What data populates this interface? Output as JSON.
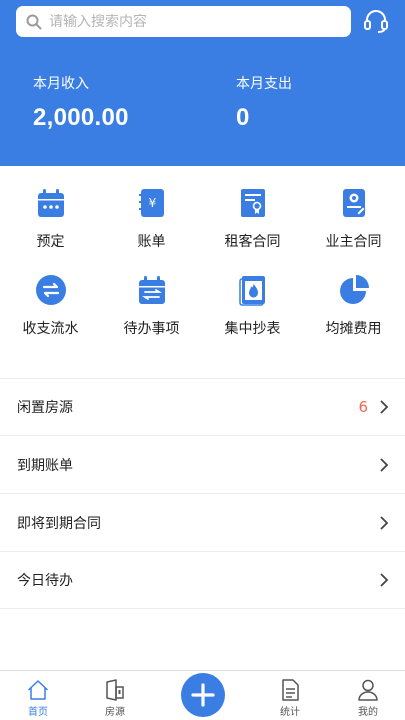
{
  "search": {
    "placeholder": "请输入搜索内容"
  },
  "colors": {
    "brand": "#3a7ee4",
    "badge": "#ef6b54"
  },
  "summary": {
    "income_label": "本月收入",
    "income_value": "2,000.00",
    "expense_label": "本月支出",
    "expense_value": "0"
  },
  "grid": [
    {
      "label": "预定",
      "icon": "calendar-icon"
    },
    {
      "label": "账单",
      "icon": "bill-icon"
    },
    {
      "label": "租客合同",
      "icon": "tenant-contract-icon"
    },
    {
      "label": "业主合同",
      "icon": "owner-contract-icon"
    },
    {
      "label": "收支流水",
      "icon": "transfer-icon"
    },
    {
      "label": "待办事项",
      "icon": "todo-calendar-icon"
    },
    {
      "label": "集中抄表",
      "icon": "meter-fire-icon"
    },
    {
      "label": "均摊费用",
      "icon": "pie-chart-icon"
    }
  ],
  "list": [
    {
      "label": "闲置房源",
      "badge": "6"
    },
    {
      "label": "到期账单",
      "badge": ""
    },
    {
      "label": "即将到期合同",
      "badge": ""
    },
    {
      "label": "今日待办",
      "badge": ""
    }
  ],
  "tabs": [
    {
      "label": "首页",
      "icon": "home-icon"
    },
    {
      "label": "房源",
      "icon": "property-icon"
    },
    {
      "label": "",
      "icon": "plus-icon"
    },
    {
      "label": "统计",
      "icon": "document-icon"
    },
    {
      "label": "我的",
      "icon": "user-icon"
    }
  ]
}
